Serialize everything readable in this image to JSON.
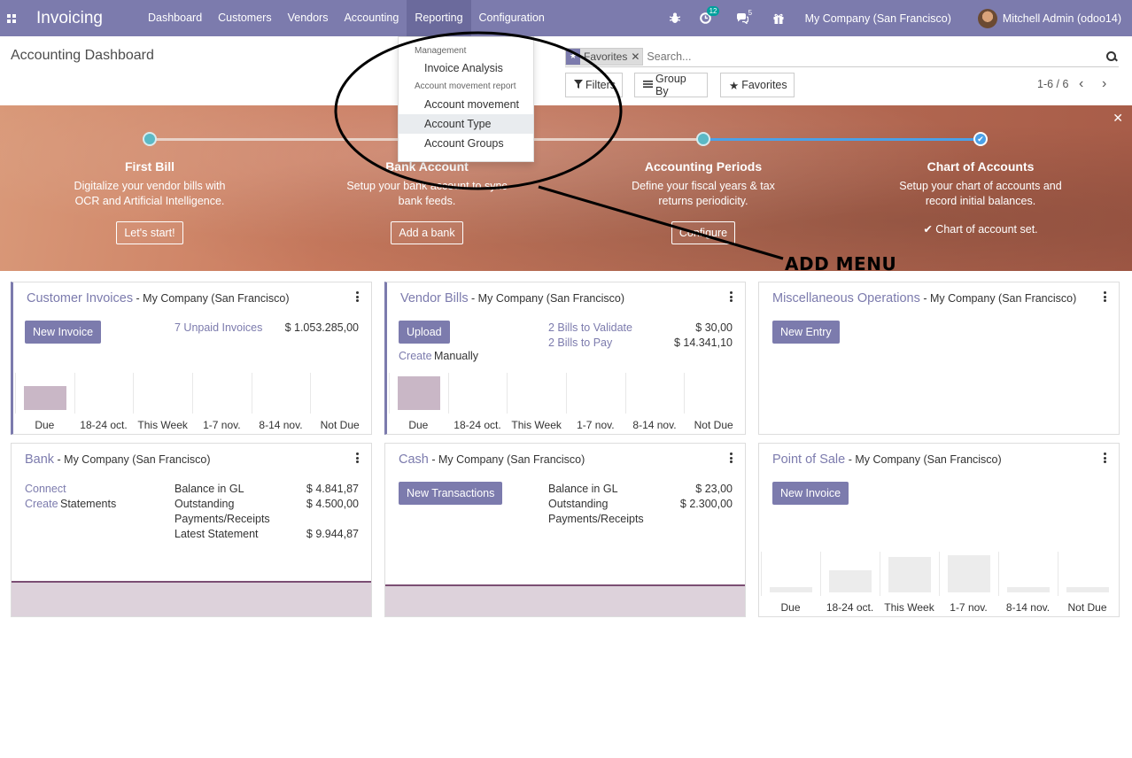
{
  "navbar": {
    "brand": "Invoicing",
    "menu": [
      "Dashboard",
      "Customers",
      "Vendors",
      "Accounting",
      "Reporting",
      "Configuration"
    ],
    "active_menu": "Reporting",
    "activity_count": "12",
    "message_count": "5",
    "company": "My Company (San Francisco)",
    "user": "Mitchell Admin (odoo14)"
  },
  "control_panel": {
    "title": "Accounting Dashboard",
    "facet": "Favorites",
    "search_placeholder": "Search...",
    "filters_label": "Filters",
    "groupby_label": "Group By",
    "favorites_label": "Favorites",
    "pager": "1-6 / 6"
  },
  "dropdown": {
    "section1": "Management",
    "item1": "Invoice Analysis",
    "section2": "Account movement report",
    "item2": "Account movement",
    "item3": "Account Type",
    "item4": "Account Groups"
  },
  "banner": {
    "steps": [
      {
        "title": "First Bill",
        "line1": "Digitalize your vendor bills with",
        "line2": "OCR and Artificial Intelligence.",
        "button": "Let's start!"
      },
      {
        "title": "Bank Account",
        "line1": "Setup your bank account to sync",
        "line2": "bank feeds.",
        "button": "Add a bank"
      },
      {
        "title": "Accounting Periods",
        "line1": "Define your fiscal years & tax",
        "line2": "returns periodicity.",
        "button": "Configure"
      },
      {
        "title": "Chart of Accounts",
        "line1": "Setup your chart of accounts and",
        "line2": "record initial balances.",
        "done": "Chart of account set."
      }
    ]
  },
  "annotation": "ADD  MENU",
  "cards": {
    "customer_invoices": {
      "title": "Customer Invoices",
      "company": " - My Company (San Francisco)",
      "button": "New Invoice",
      "unpaid_link": "7 Unpaid Invoices",
      "unpaid_amount": "$ 1.053.285,00"
    },
    "vendor_bills": {
      "title": "Vendor Bills",
      "company": " - My Company (San Francisco)",
      "button": "Upload",
      "validate_link": "2 Bills to Validate",
      "validate_amount": "$ 30,00",
      "pay_link": "2 Bills to Pay",
      "pay_amount": "$ 14.341,10",
      "create_link": "Create",
      "create_text": "Manually"
    },
    "misc": {
      "title": "Miscellaneous Operations",
      "company": " - My Company (San Francisco)",
      "button": "New Entry"
    },
    "bank": {
      "title": "Bank",
      "company": " - My Company (San Francisco)",
      "connect_link": "Connect",
      "create_link": "Create",
      "create_text": "Statements",
      "gl_label": "Balance in GL",
      "gl_amount": "$ 4.841,87",
      "outstanding_label1": "Outstanding",
      "outstanding_label2": "Payments/Receipts",
      "outstanding_amount": "$ 4.500,00",
      "latest_label": "Latest Statement",
      "latest_amount": "$ 9.944,87"
    },
    "cash": {
      "title": "Cash",
      "company": " - My Company (San Francisco)",
      "button": "New Transactions",
      "gl_label": "Balance in GL",
      "gl_amount": "$ 23,00",
      "outstanding_label1": "Outstanding",
      "outstanding_label2": "Payments/Receipts",
      "outstanding_amount": "$ 2.300,00"
    },
    "pos": {
      "title": "Point of Sale",
      "company": " - My Company (San Francisco)",
      "button": "New Invoice"
    }
  },
  "chart_data": [
    {
      "type": "bar",
      "categories": [
        "Due",
        "18-24 oct.",
        "This Week",
        "1-7 nov.",
        "8-14 nov.",
        "Not Due"
      ],
      "values": [
        0.7,
        0,
        0,
        0,
        0,
        0
      ],
      "color": "#c9b7c6"
    },
    {
      "type": "bar",
      "categories": [
        "Due",
        "18-24 oct.",
        "This Week",
        "1-7 nov.",
        "8-14 nov.",
        "Not Due"
      ],
      "values": [
        1.0,
        0,
        0,
        0,
        0,
        0
      ],
      "color": "#c9b7c6"
    },
    {
      "type": "bar",
      "categories": [
        "Due",
        "18-24 oct.",
        "This Week",
        "1-7 nov.",
        "8-14 nov.",
        "Not Due"
      ],
      "values": [
        0.15,
        0.6,
        0.95,
        1.0,
        0.15,
        0.15
      ],
      "color": "#ececec"
    }
  ]
}
